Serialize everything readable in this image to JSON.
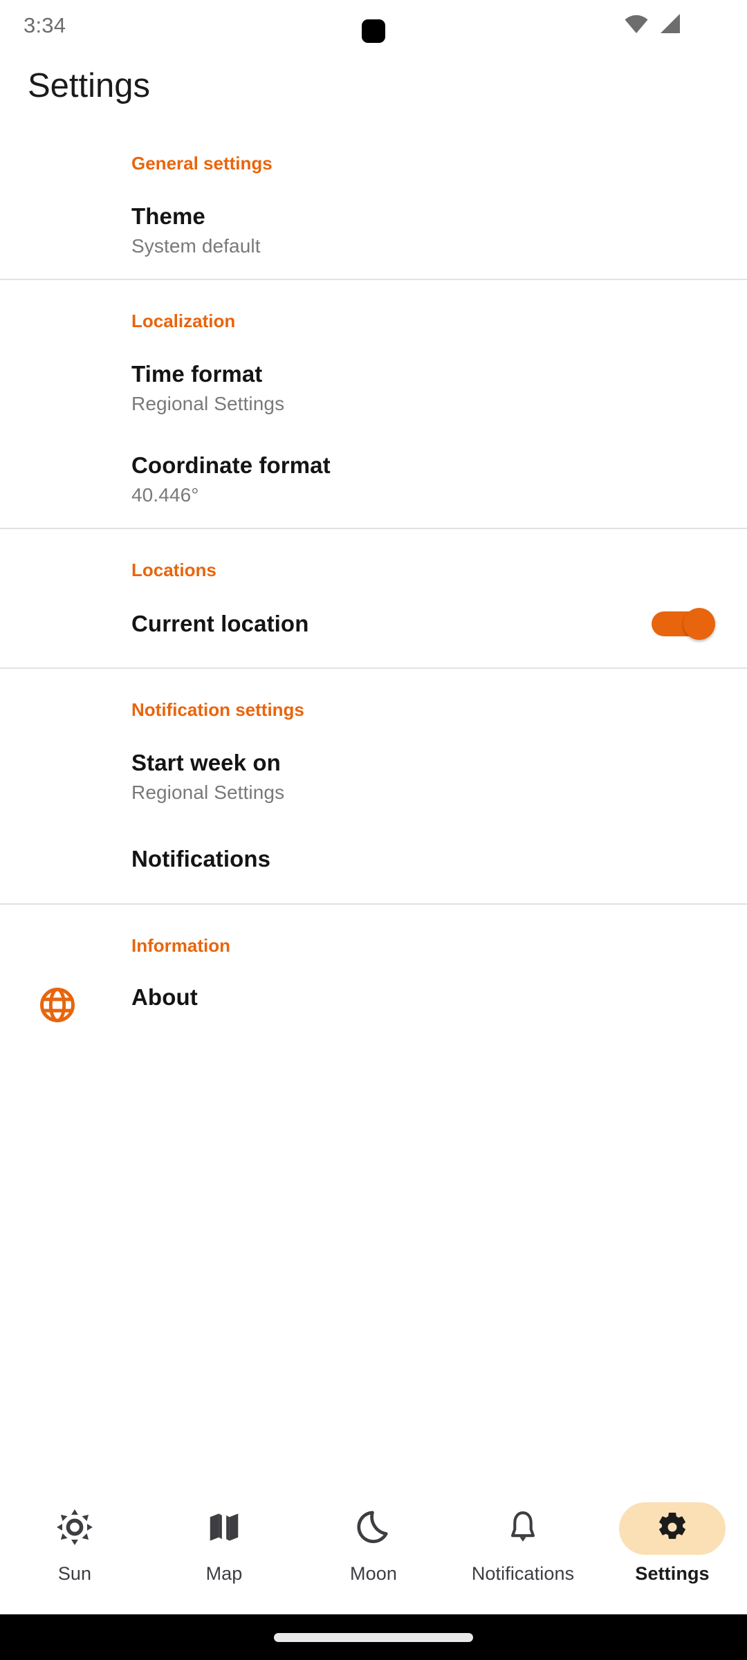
{
  "status_bar": {
    "clock": "3:34",
    "icons": [
      "wifi-icon",
      "cellular-signal-icon"
    ]
  },
  "header": {
    "title": "Settings"
  },
  "colors": {
    "accent_orange": "#e8650d",
    "selected_pill": "#fbe0b5",
    "divider": "#e2e2e2",
    "subtitle_grey": "#78797a",
    "title_black": "#141414"
  },
  "sections": [
    {
      "header": "General settings",
      "rows": [
        {
          "title": "Theme",
          "subtitle": "System default",
          "icon": "",
          "control": "none"
        }
      ]
    },
    {
      "header": "Localization",
      "rows": [
        {
          "title": "Time format",
          "subtitle": "Regional Settings",
          "icon": "",
          "control": "none"
        },
        {
          "title": "Coordinate format",
          "subtitle": "40.446°",
          "icon": "",
          "control": "none"
        }
      ]
    },
    {
      "header": "Locations",
      "rows": [
        {
          "title": "Current location",
          "subtitle": "",
          "icon": "",
          "control": "switch",
          "switch_on": true
        }
      ]
    },
    {
      "header": "Notification settings",
      "rows": [
        {
          "title": "Start week on",
          "subtitle": "Regional Settings",
          "icon": "",
          "control": "none"
        },
        {
          "title": "Notifications",
          "subtitle": "",
          "icon": "",
          "control": "none"
        }
      ]
    },
    {
      "header": "Information",
      "rows": [
        {
          "title": "About",
          "subtitle": "",
          "icon": "globe-icon",
          "control": "none"
        }
      ]
    }
  ],
  "bottom_nav": {
    "items": [
      {
        "label": "Sun",
        "icon": "sun-icon",
        "selected": false
      },
      {
        "label": "Map",
        "icon": "map-icon",
        "selected": false
      },
      {
        "label": "Moon",
        "icon": "moon-icon",
        "selected": false
      },
      {
        "label": "Notifications",
        "icon": "bell-icon",
        "selected": false
      },
      {
        "label": "Settings",
        "icon": "gear-icon",
        "selected": true
      }
    ]
  },
  "gesture_bar": {
    "handle": "home-handle"
  }
}
